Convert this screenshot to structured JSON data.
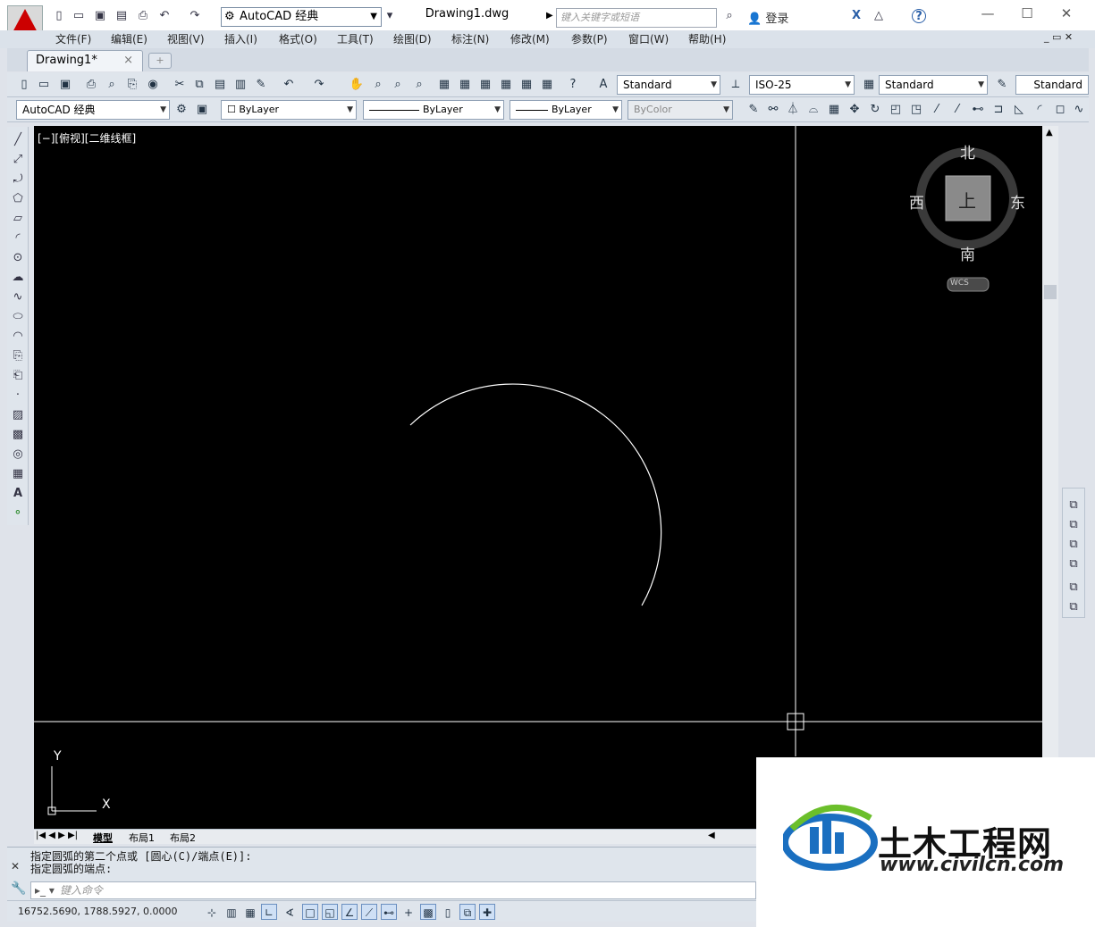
{
  "app": {
    "logo_letter": "A",
    "workspace": "AutoCAD 经典",
    "document_title": "Drawing1.dwg",
    "search_placeholder": "键入关键字或短语",
    "signin": "登录",
    "help": "?"
  },
  "window_controls": {
    "minimize": "—",
    "maximize": "☐",
    "close": "✕"
  },
  "menu": [
    "文件(F)",
    "编辑(E)",
    "视图(V)",
    "插入(I)",
    "格式(O)",
    "工具(T)",
    "绘图(D)",
    "标注(N)",
    "修改(M)",
    "参数(P)",
    "窗口(W)",
    "帮助(H)"
  ],
  "tabs": {
    "doc_tab": "Drawing1*",
    "close": "×",
    "new_tab": "+"
  },
  "styles_toolbar": {
    "text_style": "Standard",
    "dim_style": "ISO-25",
    "table_style": "Standard",
    "mleader_style": "Standard"
  },
  "layers_toolbar": {
    "workspace": "AutoCAD 经典",
    "layer": "ByLayer",
    "linetype": "ByLayer",
    "lineweight": "ByLayer",
    "plotstyle": "ByColor"
  },
  "viewport": {
    "label": "[−][俯视][二维线框]",
    "viewcube": {
      "north": "北",
      "south": "南",
      "east": "东",
      "west": "西",
      "face": "上",
      "wcs": "WCS"
    },
    "ucs_x": "X",
    "ucs_y": "Y"
  },
  "layout_tabs": [
    "模型",
    "布局1",
    "布局2"
  ],
  "command": {
    "history": [
      "指定圆弧的第二个点或 [圆心(C)/端点(E)]:",
      "指定圆弧的端点:"
    ],
    "placeholder": "键入命令"
  },
  "status": {
    "coordinates": "16752.5690, 1788.5927, 0.0000"
  },
  "watermark": {
    "title": "土木工程网",
    "url": "www.civilcn.com"
  },
  "colors": {
    "canvas": "#000000",
    "crosshair": "#ffffff",
    "accent": "#c00000",
    "watermark_blue": "#1a6fc0",
    "watermark_green": "#6bbf2b"
  }
}
